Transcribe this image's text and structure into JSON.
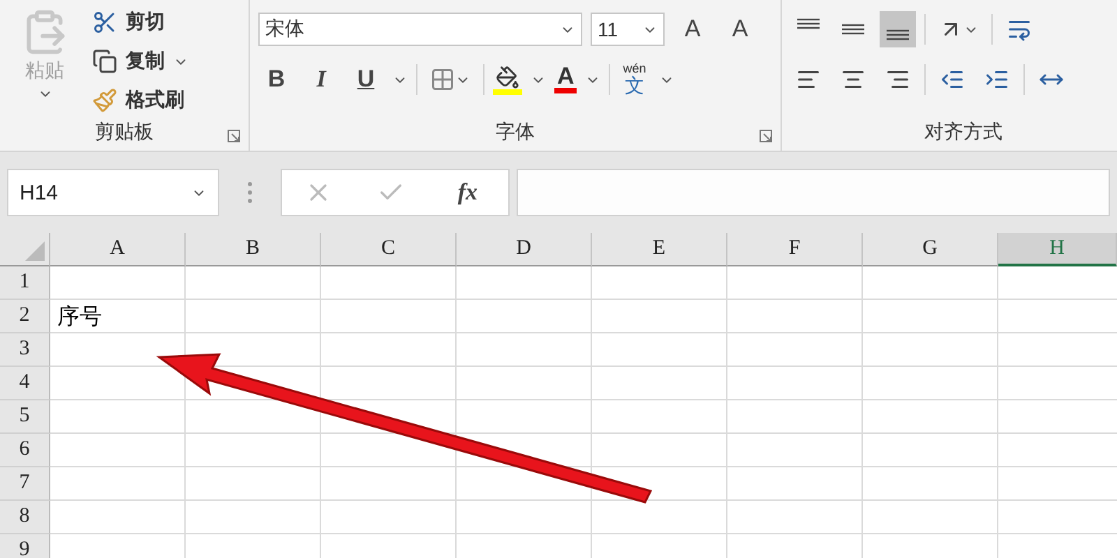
{
  "ribbon": {
    "clipboard": {
      "paste": "粘贴",
      "cut": "剪切",
      "copy": "复制",
      "format_painter": "格式刷",
      "label": "剪贴板"
    },
    "font": {
      "font_name": "宋体",
      "font_size": "11",
      "grow": "A",
      "shrink": "A",
      "bold": "B",
      "italic": "I",
      "underline": "U",
      "font_color": "A",
      "phonetic_top": "wén",
      "phonetic": "文",
      "label": "字体"
    },
    "alignment": {
      "vertical": [
        {
          "kind": "top",
          "selected": false
        },
        {
          "kind": "middle",
          "selected": false
        },
        {
          "kind": "bottom",
          "selected": true
        }
      ],
      "horizontal": [
        {
          "kind": "left"
        },
        {
          "kind": "center"
        },
        {
          "kind": "right"
        }
      ],
      "label": "对齐方式"
    }
  },
  "formula_bar": {
    "name_box": "H14",
    "fx": "fx"
  },
  "sheet": {
    "columns": [
      {
        "label": "A",
        "selected": false
      },
      {
        "label": "B",
        "selected": false
      },
      {
        "label": "C",
        "selected": false
      },
      {
        "label": "D",
        "selected": false
      },
      {
        "label": "E",
        "selected": false
      },
      {
        "label": "F",
        "selected": false
      },
      {
        "label": "G",
        "selected": false
      },
      {
        "label": "H",
        "selected": true
      }
    ],
    "rows": [
      {
        "label": "1"
      },
      {
        "label": "2",
        "values": [
          "序号"
        ]
      },
      {
        "label": "3"
      },
      {
        "label": "4"
      },
      {
        "label": "5"
      },
      {
        "label": "6"
      },
      {
        "label": "7"
      },
      {
        "label": "8"
      },
      {
        "label": "9"
      }
    ]
  }
}
